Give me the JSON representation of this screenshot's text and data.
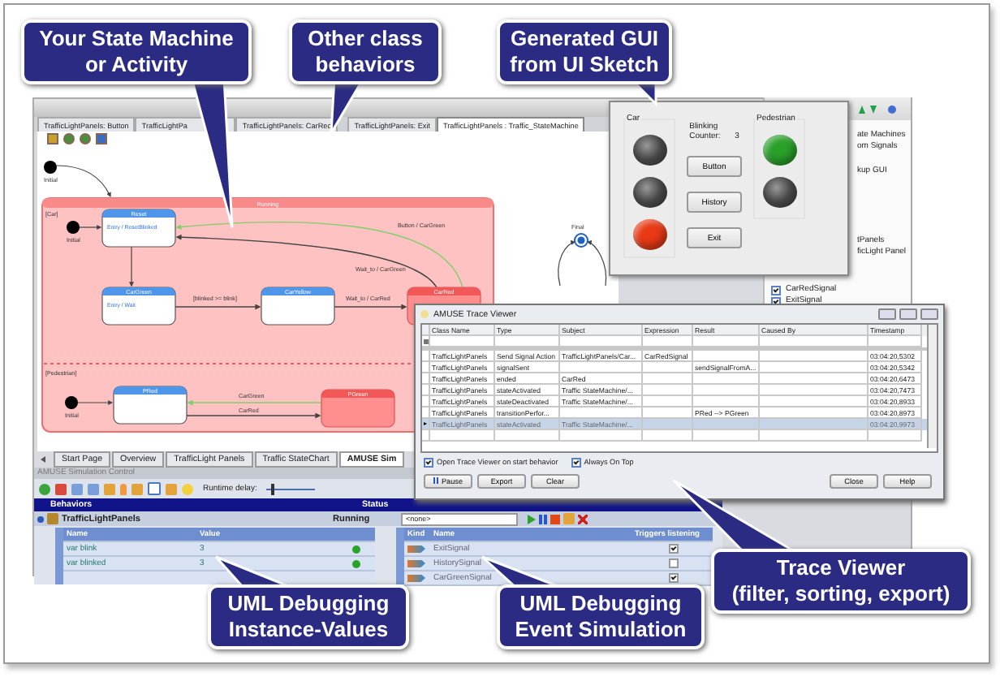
{
  "callouts": [
    {
      "lines": [
        "Your State Machine",
        "or Activity"
      ]
    },
    {
      "lines": [
        "Other class",
        "behaviors"
      ]
    },
    {
      "lines": [
        "Generated GUI",
        "from UI Sketch"
      ]
    },
    {
      "lines": [
        "Trace Viewer",
        "(filter, sorting, export)"
      ]
    },
    {
      "lines": [
        "UML Debugging",
        "Instance-Values"
      ]
    },
    {
      "lines": [
        "UML Debugging",
        "Event Simulation"
      ]
    }
  ],
  "editor": {
    "tabs": [
      {
        "label": "TrafficLightPanels: Button",
        "selected": false
      },
      {
        "label": "TrafficLightPa",
        "selected": false
      },
      {
        "label": "TrafficLightPanels: CarRed",
        "selected": false
      },
      {
        "label": "TrafficLightPanels: Exit",
        "selected": false
      },
      {
        "label": "TrafficLightPanels : Traffic_StateMachine",
        "selected": true
      }
    ],
    "diagram": {
      "initial_labels": [
        "Initial",
        "Initial",
        "Initial"
      ],
      "region": "Running",
      "partitions": [
        "[Car]",
        "[Pedestrian]"
      ],
      "states": [
        {
          "name": "Reset",
          "entry": "Entry / ResetBlinked",
          "active": false
        },
        {
          "name": "CarGreen",
          "entry": "Entry / Wait",
          "active": false
        },
        {
          "name": "CarYellow",
          "active": false
        },
        {
          "name": "CarRed",
          "active": true
        },
        {
          "name": "PRed",
          "active": false
        },
        {
          "name": "PGreen",
          "active": true
        }
      ],
      "transitions": [
        "[blinked >= blink]",
        "Wait_to / CarRed",
        "Button / CarGreen",
        "Wait_to / CarGreen",
        "CarGreen",
        "CarRed"
      ],
      "final_label": "Final"
    },
    "bottom_tabs": [
      {
        "label": "Start Page",
        "selected": false
      },
      {
        "label": "Overview",
        "selected": false
      },
      {
        "label": "TrafficLight Panels",
        "selected": false
      },
      {
        "label": "Traffic StateChart",
        "selected": false
      },
      {
        "label": "AMUSE Sim",
        "selected": true
      }
    ]
  },
  "explorer": {
    "items": [
      "ate Machines",
      "om Signals",
      "kup GUI",
      "tPanels",
      "ficLight Panel"
    ],
    "signals": [
      {
        "label": "CarRedSignal",
        "checked": true
      },
      {
        "label": "ExitSignal",
        "checked": true
      }
    ]
  },
  "gui": {
    "car_label": "Car",
    "pedestrian_label": "Pedestrian",
    "counter_label": "Blinking Counter:",
    "counter": "3",
    "buttons": [
      "Button",
      "History",
      "Exit"
    ],
    "car_lamps": [
      {
        "on": false
      },
      {
        "on": false
      },
      {
        "on": true,
        "color": "#e83a14"
      }
    ],
    "pedestrian_lamps": [
      {
        "on": true,
        "color": "#2aa02a"
      },
      {
        "on": false
      }
    ]
  },
  "trace": {
    "title": "AMUSE Trace Viewer",
    "columns": [
      "Class Name",
      "Type",
      "Subject",
      "Expression",
      "Result",
      "Caused By",
      "Timestamp"
    ],
    "rows": [
      {
        "class_name": "TrafficLightPanels",
        "type": "Send Signal Action",
        "subject": "TrafficLightPanels/Car...",
        "expression": "CarRedSignal",
        "timestamp": "03:04:20,5302",
        "selected": false
      },
      {
        "class_name": "TrafficLightPanels",
        "type": "signalSent",
        "result": "sendSignalFromA...",
        "timestamp": "03:04:20,5342",
        "selected": false
      },
      {
        "class_name": "TrafficLightPanels",
        "type": "ended",
        "subject": "CarRed",
        "timestamp": "03:04:20,6473",
        "selected": false
      },
      {
        "class_name": "TrafficLightPanels",
        "type": "stateActivated",
        "subject": "Traffic StateMachine/...",
        "timestamp": "03:04:20,7473",
        "selected": false
      },
      {
        "class_name": "TrafficLightPanels",
        "type": "stateDeactivated",
        "subject": "Traffic StateMachine/...",
        "timestamp": "03:04:20,8933",
        "selected": false
      },
      {
        "class_name": "TrafficLightPanels",
        "type": "transitionPerfor...",
        "result": "PRed --> PGreen",
        "timestamp": "03:04:20,8973",
        "selected": false
      },
      {
        "class_name": "TrafficLightPanels",
        "type": "stateActivated",
        "subject": "Traffic StateMachine/...",
        "timestamp": "03:04:20,9973",
        "selected": true
      }
    ],
    "options": [
      {
        "label": "Open Trace Viewer on start behavior",
        "checked": true
      },
      {
        "label": "Always On Top",
        "checked": true
      }
    ],
    "left_buttons": [
      "Pause",
      "Export",
      "Clear"
    ],
    "right_buttons": [
      "Close",
      "Help"
    ]
  },
  "simulation": {
    "title": "AMUSE Simulation Control",
    "runtime_label": "Runtime delay:",
    "runtime": {
      "level": 0.08
    },
    "columns": [
      "Behaviors",
      "Status"
    ],
    "behavior": {
      "name": "TrafficLightPanels",
      "status": "Running"
    },
    "event_filter": "<none>",
    "attributes": {
      "columns": [
        "Name",
        "Value"
      ],
      "rows": [
        {
          "name": "var blink",
          "value": "3",
          "ok": true
        },
        {
          "name": "var blinked",
          "value": "3",
          "ok": true
        }
      ]
    },
    "events": {
      "columns": [
        "Kind",
        "Name",
        "Triggers listening"
      ],
      "rows": [
        {
          "name": "ExitSignal",
          "checked": true
        },
        {
          "name": "HistorySignal",
          "checked": false
        },
        {
          "name": "CarGreenSignal",
          "checked": true
        }
      ]
    }
  }
}
